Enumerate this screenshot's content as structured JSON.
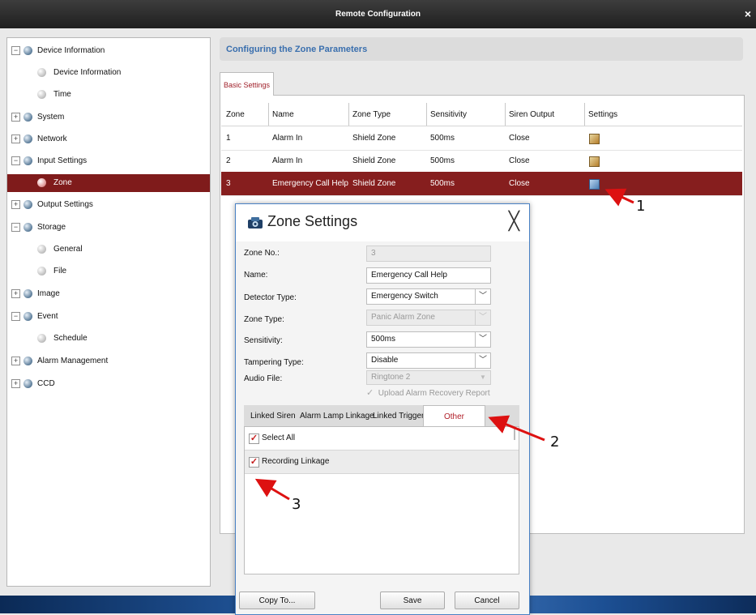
{
  "window": {
    "title": "Remote Configuration",
    "close_glyph": "×"
  },
  "sidebar": {
    "items": [
      {
        "label": "Device Information",
        "level": 0,
        "expand": "−"
      },
      {
        "label": "Device Information",
        "level": 1
      },
      {
        "label": "Time",
        "level": 1
      },
      {
        "label": "System",
        "level": 0,
        "expand": "+"
      },
      {
        "label": "Network",
        "level": 0,
        "expand": "+"
      },
      {
        "label": "Input Settings",
        "level": 0,
        "expand": "−"
      },
      {
        "label": "Zone",
        "level": 1,
        "active": true
      },
      {
        "label": "Output Settings",
        "level": 0,
        "expand": "+"
      },
      {
        "label": "Storage",
        "level": 0,
        "expand": "−"
      },
      {
        "label": "General",
        "level": 1
      },
      {
        "label": "File",
        "level": 1
      },
      {
        "label": "Image",
        "level": 0,
        "expand": "+"
      },
      {
        "label": "Event",
        "level": 0,
        "expand": "−"
      },
      {
        "label": "Schedule",
        "level": 1
      },
      {
        "label": "Alarm Management",
        "level": 0,
        "expand": "+"
      },
      {
        "label": "CCD",
        "level": 0,
        "expand": "+"
      }
    ]
  },
  "main": {
    "section_title": "Configuring the Zone Parameters",
    "tab_label": "Basic Settings",
    "columns": [
      "Zone",
      "Name",
      "Zone Type",
      "Sensitivity",
      "Siren Output",
      "Settings"
    ],
    "rows": [
      {
        "zone": "1",
        "name": "Alarm In",
        "zone_type": "Shield Zone",
        "sensitivity": "500ms",
        "siren": "Close"
      },
      {
        "zone": "2",
        "name": "Alarm In",
        "zone_type": "Shield Zone",
        "sensitivity": "500ms",
        "siren": "Close"
      },
      {
        "zone": "3",
        "name": "Emergency Call Help",
        "zone_type": "Shield Zone",
        "sensitivity": "500ms",
        "siren": "Close",
        "selected": true
      }
    ]
  },
  "dialog": {
    "title": "Zone Settings",
    "close_glyph": "╳",
    "fields": {
      "zone_no": {
        "label": "Zone No.:",
        "value": "3"
      },
      "name": {
        "label": "Name:",
        "value": "Emergency Call Help"
      },
      "detector_type": {
        "label": "Detector Type:",
        "value": "Emergency Switch"
      },
      "zone_type": {
        "label": "Zone Type:",
        "value": "Panic Alarm Zone"
      },
      "sensitivity": {
        "label": "Sensitivity:",
        "value": "500ms"
      },
      "tampering_type": {
        "label": "Tampering Type:",
        "value": "Disable"
      },
      "audio_file": {
        "label": "Audio File:",
        "value": "Ringtone 2"
      }
    },
    "upload_check": "Upload Alarm Recovery Report",
    "subtabs": [
      "Linked Siren",
      "Alarm Lamp Linkage",
      "Linked Trigger",
      "Other"
    ],
    "list": [
      "Select All",
      "Recording Linkage"
    ],
    "buttons": {
      "copy": "Copy To...",
      "save": "Save",
      "cancel": "Cancel"
    }
  },
  "annotations": [
    "1",
    "2",
    "3"
  ],
  "colors": {
    "accent_red": "#861e1e",
    "header_blue": "#3a6fae"
  }
}
